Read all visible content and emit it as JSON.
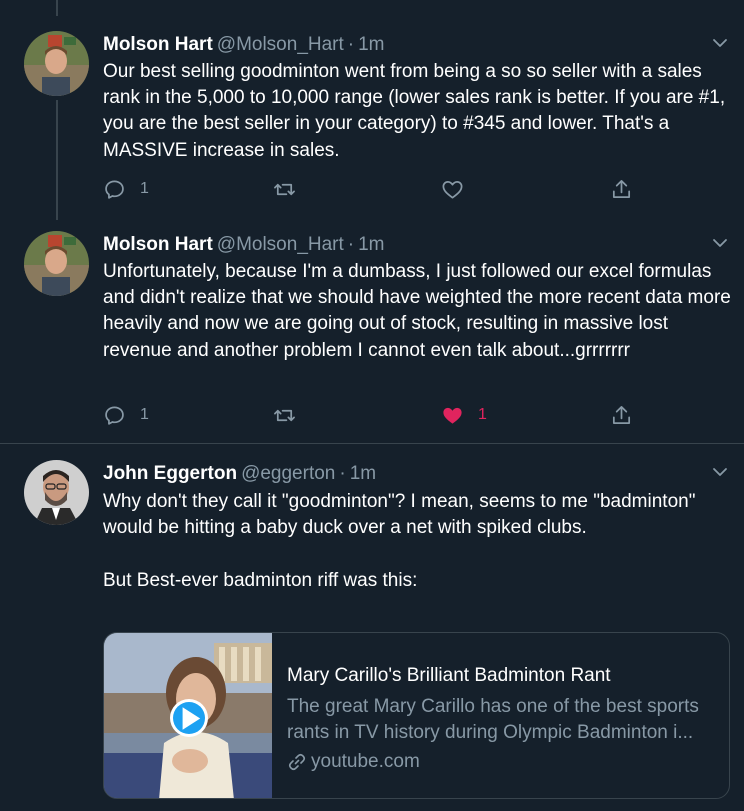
{
  "tweets": [
    {
      "name": "Molson Hart",
      "handle": "@Molson_Hart",
      "dot": "·",
      "time": "1m",
      "text": "Our best selling goodminton went from being a so so seller with a sales rank in the 5,000 to 10,000 range (lower sales rank is better. If you are #1, you are the best seller in your category) to #345 and lower. That's a MASSIVE increase in sales.",
      "reply_count": "1",
      "like_count": ""
    },
    {
      "name": "Molson Hart",
      "handle": "@Molson_Hart",
      "dot": "·",
      "time": "1m",
      "text": "Unfortunately, because I'm a dumbass, I just followed our excel formulas and didn't realize that we should have weighted the more recent data more heavily and now we are going out of stock, resulting in massive lost revenue and another problem I cannot even talk about...grrrrrrr",
      "reply_count": "1",
      "like_count": "1"
    },
    {
      "name": "John Eggerton",
      "handle": "@eggerton",
      "dot": "·",
      "time": "1m",
      "text": "Why don't they call it \"goodminton\"? I mean, seems to me \"badminton\" would be hitting a baby duck over a net with spiked clubs.\n\nBut Best-ever badminton riff was this:"
    }
  ],
  "card": {
    "title": "Mary Carillo's Brilliant Badminton Rant",
    "description": "The great Mary Carillo has one of the best sports rants in TV history during Olympic Badminton i...",
    "domain": "youtube.com"
  },
  "colors": {
    "background": "#15202b",
    "secondary_text": "#8899a6",
    "border": "#38444d",
    "like_active": "#e0245e",
    "accent": "#1da1f2"
  }
}
